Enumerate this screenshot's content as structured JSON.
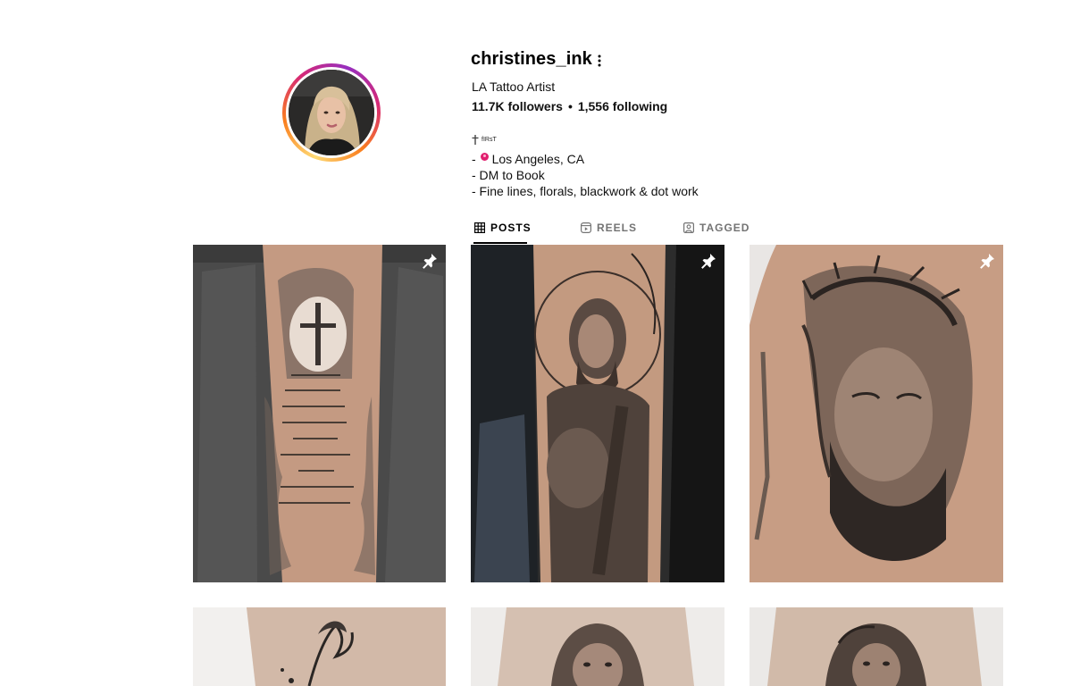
{
  "profile": {
    "username": "christines_ink",
    "display_name": "LA Tattoo Artist",
    "followers": "11.7K followers",
    "following": "1,556 following",
    "separator": "•",
    "tag_line": "fIRsT",
    "bio_line_1_prefix": "-",
    "bio_line_1": "Los Angeles, CA",
    "bio_line_2": "- DM to Book",
    "bio_line_3": "- Fine lines, florals, blackwork & dot work"
  },
  "tabs": [
    {
      "label": "POSTS",
      "icon": "grid-icon",
      "active": true
    },
    {
      "label": "REELS",
      "icon": "reels-icon",
      "active": false
    },
    {
      "label": "TAGGED",
      "icon": "tagged-icon",
      "active": false
    }
  ],
  "posts": [
    {
      "name": "post-scripture-cross-forearm",
      "pinned": true
    },
    {
      "name": "post-saint-jude-forearm",
      "pinned": true
    },
    {
      "name": "post-jesus-crown-of-thorns",
      "pinned": true
    },
    {
      "name": "post-mermaid-tail",
      "pinned": false
    },
    {
      "name": "post-lion-dotwork-1",
      "pinned": false
    },
    {
      "name": "post-lion-dotwork-2",
      "pinned": false
    }
  ],
  "colors": {
    "text_primary": "#000000",
    "text_secondary": "#737373",
    "story_ring_start": "#feda75",
    "story_ring_end": "#962fbf",
    "location_pin": "#e01e6e"
  }
}
